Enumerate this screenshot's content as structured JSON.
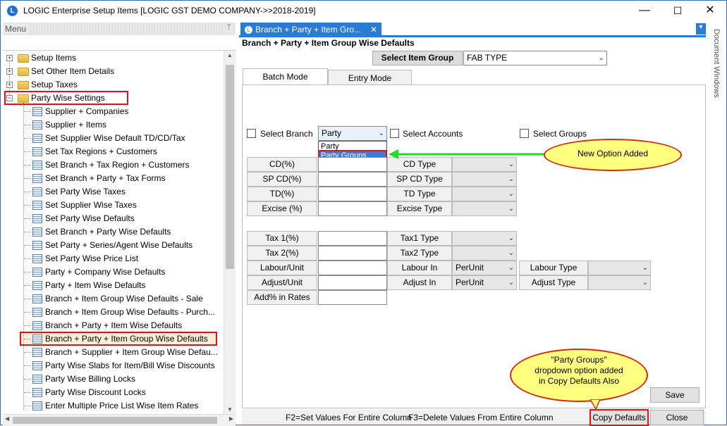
{
  "window": {
    "title": "LOGIC Enterprise Setup Items  [LOGIC GST DEMO COMPANY->>2018-2019]",
    "app_icon": "L",
    "min_label": "—",
    "max_label": "☐",
    "close_label": "✕"
  },
  "menu": {
    "header": "Menu",
    "pin_icon": "pin-icon",
    "pin_glyph": "ᛘ",
    "tree": [
      {
        "label": "Setup Items",
        "type": "folder",
        "expander": "+"
      },
      {
        "label": "Set Other Item Details",
        "type": "folder",
        "expander": "+"
      },
      {
        "label": "Setup Taxes",
        "type": "folder",
        "expander": "+"
      },
      {
        "label": "Party Wise Settings",
        "type": "folder",
        "expander": "−"
      },
      {
        "label": "Supplier + Companies",
        "type": "leaf"
      },
      {
        "label": "Supplier + Items",
        "type": "leaf"
      },
      {
        "label": "Set Supplier Wise Default TD/CD/Tax",
        "type": "leaf"
      },
      {
        "label": "Set Tax Regions + Customers",
        "type": "leaf"
      },
      {
        "label": "Set Branch + Tax Region + Customers",
        "type": "leaf"
      },
      {
        "label": "Set Branch + Party + Tax Forms",
        "type": "leaf"
      },
      {
        "label": "Set Party Wise Taxes",
        "type": "leaf"
      },
      {
        "label": "Set Supplier Wise Taxes",
        "type": "leaf"
      },
      {
        "label": "Set Party Wise Defaults",
        "type": "leaf"
      },
      {
        "label": "Set Branch + Party Wise Defaults",
        "type": "leaf"
      },
      {
        "label": "Set Party + Series/Agent Wise Defaults",
        "type": "leaf"
      },
      {
        "label": "Set Party Wise Price List",
        "type": "leaf"
      },
      {
        "label": "Party + Company Wise Defaults",
        "type": "leaf"
      },
      {
        "label": "Party + Item Wise Defaults",
        "type": "leaf"
      },
      {
        "label": "Branch + Item Group Wise Defaults - Sale",
        "type": "leaf"
      },
      {
        "label": "Branch + Item Group Wise Defaults - Purch...",
        "type": "leaf"
      },
      {
        "label": "Branch + Party + Item Wise Defaults",
        "type": "leaf"
      },
      {
        "label": "Branch + Party + Item Group Wise Defaults",
        "type": "leaf"
      },
      {
        "label": "Branch + Supplier + Item Group Wise Defau...",
        "type": "leaf"
      },
      {
        "label": "Party Wise Slabs for Item/Bill Wise Discounts",
        "type": "leaf"
      },
      {
        "label": "Party Wise Billing Locks",
        "type": "leaf"
      },
      {
        "label": "Party Wise Discount Locks",
        "type": "leaf"
      },
      {
        "label": "Enter Multiple Price List Wise Item Rates",
        "type": "leaf"
      }
    ]
  },
  "main": {
    "tab_label": "Branch + Party + Item Gro...",
    "tab_close": "✕",
    "tab_dropdown_glyph": "▾",
    "doc_title": "Branch + Party + Item Group Wise Defaults",
    "select_item_group_label": "Select Item Group",
    "item_group_value": "FAB TYPE",
    "subtabs": [
      "Batch Mode",
      "Entry Mode"
    ],
    "select_branch_label": "Select Branch",
    "branch_combo_value": "Party",
    "branch_options": [
      "Party",
      "Party Groups"
    ],
    "select_accounts_label": "Select Accounts",
    "select_groups_label": "Select Groups",
    "rows1": [
      {
        "left": "CD(%)",
        "right": "CD Type"
      },
      {
        "left": "SP CD(%)",
        "right": "SP CD Type"
      },
      {
        "left": "TD(%)",
        "right": "TD Type"
      },
      {
        "left": "Excise (%)",
        "right": "Excise Type"
      }
    ],
    "rows2": [
      {
        "left": "Tax 1(%)",
        "right": "Tax1 Type"
      },
      {
        "left": "Tax 2(%)",
        "right": "Tax2 Type"
      }
    ],
    "labour_unit_label": "Labour/Unit",
    "labour_in_label": "Labour In",
    "labour_in_value": "PerUnit",
    "labour_type_label": "Labour Type",
    "adjust_unit_label": "Adjust/Unit",
    "adjust_in_label": "Adjust In",
    "adjust_in_value": "PerUnit",
    "adjust_type_label": "Adjust Type",
    "add_rates_label": "Add% in Rates",
    "save_label": "Save",
    "status_f2": "F2=Set Values For Entire Column",
    "status_f3": "F3=Delete Values From Entire Column",
    "copy_defaults_label": "Copy Defaults",
    "close_label": "Close",
    "doc_windows_label": "Document Windows"
  },
  "annotations": {
    "new_option": "New Option Added",
    "copy_note": "\"Party Groups\" dropdown option added in Copy Defaults Also"
  },
  "colors": {
    "accent": "#2a7bd5",
    "highlight": "#e0101c",
    "callout": "#ffff80",
    "arrow": "#22dd22"
  }
}
